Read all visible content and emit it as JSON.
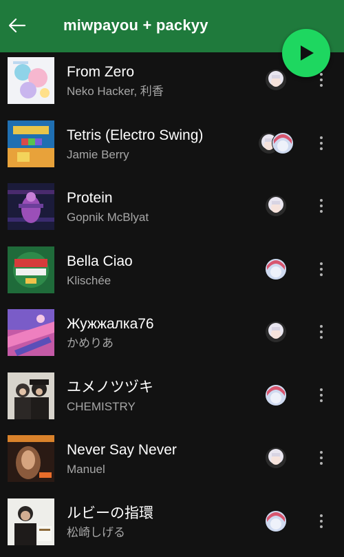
{
  "header": {
    "title": "miwpayou + packyy",
    "back_icon": "arrow-left-icon",
    "play_icon": "play-icon",
    "accent": "#1ed760",
    "bar_color": "#1f7a3c"
  },
  "tracks": [
    {
      "title": "From Zero",
      "artist": "Neko Hacker, 利香",
      "added_by": [
        "white-hair-avatar"
      ]
    },
    {
      "title": "Tetris (Electro Swing)",
      "artist": "Jamie Berry",
      "added_by": [
        "white-hair-avatar",
        "pink-hair-avatar"
      ]
    },
    {
      "title": "Protein",
      "artist": "Gopnik McBlyat",
      "added_by": [
        "white-hair-avatar"
      ]
    },
    {
      "title": "Bella Ciao",
      "artist": "Klischée",
      "added_by": [
        "pink-hair-avatar"
      ]
    },
    {
      "title": "Жужжалка76",
      "artist": "かめりあ",
      "added_by": [
        "white-hair-avatar"
      ]
    },
    {
      "title": "ユメノツヅキ",
      "artist": "CHEMISTRY",
      "added_by": [
        "pink-hair-avatar"
      ]
    },
    {
      "title": "Never Say Never",
      "artist": "Manuel",
      "added_by": [
        "white-hair-avatar"
      ]
    },
    {
      "title": "ルビーの指環",
      "artist": "松崎しげる",
      "added_by": [
        "pink-hair-avatar"
      ]
    }
  ]
}
